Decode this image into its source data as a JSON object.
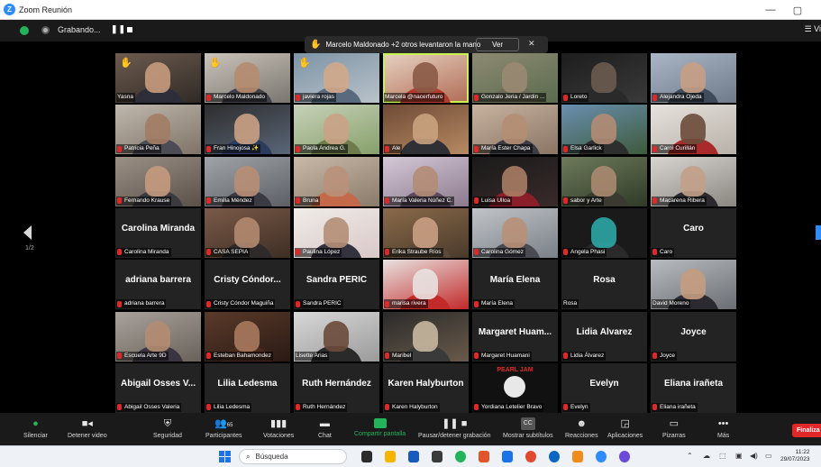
{
  "window": {
    "title": "Zoom Reunión",
    "controls": [
      "—",
      "▢"
    ]
  },
  "topbar": {
    "recording_label": "Grabando...",
    "pause": "❚❚",
    "view_label": "☰ Vi"
  },
  "notification": {
    "text": "Marcelo Maldonado +2 otros levantaron la mano",
    "button": "Ver",
    "close": "✕"
  },
  "pager": {
    "indicator": "1/2"
  },
  "colors": {
    "accent": "#2d8cff",
    "green": "#23b35a",
    "red": "#e02828",
    "active_speaker": "#c8f34a"
  },
  "participants": [
    {
      "label": "Yasna",
      "kind": "video",
      "hand": true,
      "mic_off": false,
      "c1": "#6d5b4e",
      "c2": "#2f2a26",
      "h": "#c79b7c",
      "s": "#2e2e3a"
    },
    {
      "label": "Marcelo Maldonado",
      "kind": "video",
      "hand": true,
      "mic_off": true,
      "c1": "#c9c3bb",
      "c2": "#7a756e",
      "h": "#b58c6f",
      "s": "#404048"
    },
    {
      "label": "javiera rojas",
      "kind": "video",
      "hand": true,
      "mic_off": true,
      "c1": "#7d94a6",
      "c2": "#b9c2c9",
      "h": "#d0a889",
      "s": "#5a6a7e"
    },
    {
      "label": "Marcela @nacerfuturo",
      "kind": "video",
      "hand": false,
      "mic_off": false,
      "active": true,
      "c1": "#e7d2c2",
      "c2": "#b06c55",
      "h": "#8a5a46",
      "s": "#b23b2f"
    },
    {
      "label": "Gonzalo Jeria / Jardin ...",
      "kind": "video",
      "hand": false,
      "mic_off": true,
      "c1": "#8d8a72",
      "c2": "#5a6b4e",
      "h": "#9a8a72",
      "s": "#6b6b58"
    },
    {
      "label": "Loreto",
      "kind": "video",
      "hand": false,
      "mic_off": true,
      "c1": "#1d1d1d",
      "c2": "#3a3a3a",
      "h": "#6b5b50",
      "s": "#2a2a2a"
    },
    {
      "label": "Alejandra Ojeda",
      "kind": "video",
      "hand": false,
      "mic_off": true,
      "c1": "#aab6c6",
      "c2": "#6f7b8a",
      "h": "#c79e84",
      "s": "#3f4a5a"
    },
    {
      "label": "Patricia Peña",
      "kind": "video",
      "hand": false,
      "mic_off": true,
      "c1": "#bfb8ae",
      "c2": "#7f7366",
      "h": "#a27c64",
      "s": "#4c4c55"
    },
    {
      "label": "Fran Hinojosa ✨",
      "kind": "video",
      "hand": false,
      "mic_off": true,
      "c1": "#2d2d2d",
      "c2": "#5a6678",
      "h": "#cba184",
      "s": "#2a3d5e"
    },
    {
      "label": "Paola Andrea G.",
      "kind": "video",
      "hand": false,
      "mic_off": true,
      "c1": "#c7d1b9",
      "c2": "#86a06a",
      "h": "#caa286",
      "s": "#6e7c4c"
    },
    {
      "label": "Ale",
      "kind": "video",
      "hand": false,
      "mic_off": true,
      "c1": "#6f4a36",
      "c2": "#b68a62",
      "h": "#c9a27f",
      "s": "#2f2f36"
    },
    {
      "label": "María Ester Chapa",
      "kind": "video",
      "hand": false,
      "mic_off": true,
      "c1": "#c7b3a0",
      "c2": "#8a7464",
      "h": "#b48e73",
      "s": "#3c3c44"
    },
    {
      "label": "Elsa Garlick",
      "kind": "video",
      "hand": false,
      "mic_off": true,
      "c1": "#6a8fb0",
      "c2": "#3d5a3b",
      "h": "#b28c74",
      "s": "#2e2e2e"
    },
    {
      "label": "Carol Curillán",
      "kind": "video",
      "hand": false,
      "mic_off": true,
      "c1": "#e6e2dd",
      "c2": "#b8b0a8",
      "h": "#6b4b3a",
      "s": "#a92a2a"
    },
    {
      "label": "Fernando Krause",
      "kind": "video",
      "hand": false,
      "mic_off": true,
      "c1": "#9a9086",
      "c2": "#5a5048",
      "h": "#c49a7e",
      "s": "#3a3a40"
    },
    {
      "label": "Emilia Méndez",
      "kind": "video",
      "hand": false,
      "mic_off": true,
      "c1": "#a0a4a8",
      "c2": "#5c6066",
      "h": "#b88e74",
      "s": "#3a3a44"
    },
    {
      "label": "Bruna",
      "kind": "video",
      "hand": false,
      "mic_off": true,
      "c1": "#c9b9a8",
      "c2": "#8a7a6a",
      "h": "#b9917a",
      "s": "#c46a4a"
    },
    {
      "label": "María Valeria Núñez C.",
      "kind": "video",
      "hand": false,
      "mic_off": true,
      "c1": "#d4c8d6",
      "c2": "#8c7a8e",
      "h": "#b38c76",
      "s": "#5a4a5e"
    },
    {
      "label": "Luisa Ulloa",
      "kind": "video",
      "hand": false,
      "mic_off": true,
      "c1": "#1a1a1a",
      "c2": "#3a2a2a",
      "h": "#a87c64",
      "s": "#8a1f2a"
    },
    {
      "label": "sabor y Arte",
      "kind": "video",
      "hand": false,
      "mic_off": true,
      "c1": "#6e7a5a",
      "c2": "#2f3a28",
      "h": "#a88a70",
      "s": "#3a3a30"
    },
    {
      "label": "Macarena Ribera",
      "kind": "video",
      "hand": false,
      "mic_off": true,
      "c1": "#d8d4d0",
      "c2": "#8a8680",
      "h": "#c2a088",
      "s": "#2a2a2e"
    },
    {
      "label": "Carolina Miranda",
      "kind": "name",
      "big": "Carolina Miranda",
      "mic_off": true
    },
    {
      "label": "CASA SEPIA",
      "kind": "video",
      "hand": false,
      "mic_off": true,
      "c1": "#7a5a48",
      "c2": "#3e2e24",
      "h": "#b38a70",
      "s": "#2e2a2a"
    },
    {
      "label": "Paulina López",
      "kind": "video",
      "hand": false,
      "mic_off": true,
      "c1": "#f0ece8",
      "c2": "#d8c8c8",
      "h": "#b48e76",
      "s": "#333340"
    },
    {
      "label": "Erika Straube Ríos",
      "kind": "video",
      "hand": false,
      "mic_off": true,
      "c1": "#8a6a4a",
      "c2": "#4a3a2a",
      "h": "#c9a084",
      "s": "#5a4a3a"
    },
    {
      "label": "Carolina Gómez",
      "kind": "video",
      "hand": false,
      "mic_off": true,
      "c1": "#c0c4c8",
      "c2": "#7a8088",
      "h": "#b89078",
      "s": "#4a4a52"
    },
    {
      "label": "Angela Phasi",
      "kind": "video",
      "hand": false,
      "mic_off": true,
      "c1": "#1a1a1a",
      "c2": "#1a1a1a",
      "h": "#2ea6a6",
      "s": "#2a2a2a"
    },
    {
      "label": "Caro",
      "kind": "name",
      "big": "Caro",
      "mic_off": true
    },
    {
      "label": "adriana barrera",
      "kind": "name",
      "big": "adriana barrera",
      "mic_off": true
    },
    {
      "label": "Cristy Cóndor Maguiña",
      "kind": "name",
      "big": "Cristy Cóndor...",
      "mic_off": true
    },
    {
      "label": "Sandra PERIC",
      "kind": "name",
      "big": "Sandra PERIC",
      "mic_off": true
    },
    {
      "label": "marisa rivera",
      "kind": "video",
      "hand": false,
      "mic_off": true,
      "c1": "#e8e2e0",
      "c2": "#c22a2a",
      "h": "#e8e2e0",
      "s": "#c22a2a"
    },
    {
      "label": "María Elena",
      "kind": "name",
      "big": "María Elena",
      "mic_off": true
    },
    {
      "label": "Rosa",
      "kind": "name",
      "big": "Rosa",
      "mic_off": false
    },
    {
      "label": "David Moreno",
      "kind": "video",
      "hand": false,
      "mic_off": false,
      "c1": "#b8bcc0",
      "c2": "#6a6e74",
      "h": "#c49c80",
      "s": "#2a2a30"
    },
    {
      "label": "Escuela Arte 9D",
      "kind": "video",
      "hand": false,
      "mic_off": true,
      "c1": "#a8a29c",
      "c2": "#6a625a",
      "h": "#b48c72",
      "s": "#3a3440"
    },
    {
      "label": "Esteban Bahamondez",
      "kind": "video",
      "hand": false,
      "mic_off": true,
      "c1": "#5a3a2a",
      "c2": "#2a1a14",
      "h": "#a87a5e",
      "s": "#4a2a1e"
    },
    {
      "label": "Lisette Arias",
      "kind": "video",
      "hand": false,
      "mic_off": false,
      "c1": "#d8d8d8",
      "c2": "#9a9a9a",
      "h": "#6a4a3a",
      "s": "#2a2a2a"
    },
    {
      "label": "Maribel",
      "kind": "video",
      "hand": false,
      "mic_off": true,
      "c1": "#2a2a2a",
      "c2": "#6a5a4a",
      "h": "#c8b8a0",
      "s": "#3a3a3a"
    },
    {
      "label": "Margaret Huamani",
      "kind": "name",
      "big": "Margaret Huam...",
      "mic_off": true
    },
    {
      "label": "Lidia Álvarez",
      "kind": "name",
      "big": "Lidia Álvarez",
      "mic_off": true
    },
    {
      "label": "Joyce",
      "kind": "name",
      "big": "Joyce",
      "mic_off": true
    },
    {
      "label": "Abigail Osses Valeria",
      "kind": "name",
      "big": "Abigail Osses V...",
      "mic_off": true
    },
    {
      "label": "Lilia Ledesma",
      "kind": "name",
      "big": "Lilia Ledesma",
      "mic_off": true
    },
    {
      "label": "Ruth Hernández",
      "kind": "name",
      "big": "Ruth Hernández",
      "mic_off": true
    },
    {
      "label": "Karen Halyburton",
      "kind": "name",
      "big": "Karen Halyburton",
      "mic_off": true
    },
    {
      "label": "Yordiana Letelier Bravo",
      "kind": "logo",
      "big": "PEARL JAM",
      "mic_off": true
    },
    {
      "label": "Evelyn",
      "kind": "name",
      "big": "Evelyn",
      "mic_off": true
    },
    {
      "label": "Eliana irañeta",
      "kind": "name",
      "big": "Eliana irañeta",
      "mic_off": true
    }
  ],
  "toolbar": {
    "mute": "Silenciar",
    "video": "Detener video",
    "security": "Seguridad",
    "participants": "Participantes",
    "participants_count": "65",
    "polls": "Votaciones",
    "chat": "Chat",
    "share": "Compartir pantalla",
    "pause_rec": "Pausar/detener grabación",
    "subtitles": "Mostrar subtítulos",
    "reactions": "Reacciones",
    "apps": "Aplicaciones",
    "whiteboards": "Pizarras",
    "more": "Más",
    "end": "Finaliza",
    "cc": "CC"
  },
  "taskbar": {
    "search_placeholder": "Búsqueda",
    "time": "11:22",
    "date": "29/07/2023"
  }
}
